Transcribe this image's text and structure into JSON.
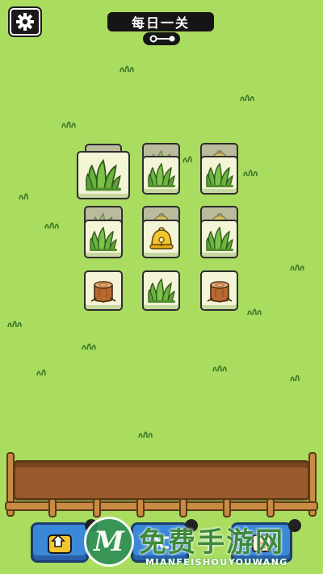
{
  "header": {
    "title": "每日一关",
    "settings_icon": "gear-icon",
    "key_icon": "key-icon"
  },
  "board": {
    "tiles": [
      {
        "icon": "stump-icon",
        "layer": "under"
      },
      {
        "icon": "grass-tuft-icon",
        "layer": "top"
      },
      {
        "icon": "grass-tuft-icon",
        "layer": "under"
      },
      {
        "icon": "grass-tuft-icon",
        "layer": "top"
      },
      {
        "icon": "bell-icon",
        "layer": "under"
      },
      {
        "icon": "grass-tuft-icon",
        "layer": "top"
      },
      {
        "icon": "grass-tuft-icon",
        "layer": "under"
      },
      {
        "icon": "grass-tuft-icon",
        "layer": "top"
      },
      {
        "icon": "bell-icon",
        "layer": "under"
      },
      {
        "icon": "bell-icon",
        "layer": "top"
      },
      {
        "icon": "bell-icon",
        "layer": "under"
      },
      {
        "icon": "grass-tuft-icon",
        "layer": "top"
      },
      {
        "icon": "stump-icon",
        "layer": "top"
      },
      {
        "icon": "grass-tuft-icon",
        "layer": "top"
      },
      {
        "icon": "stump-icon",
        "layer": "top"
      }
    ]
  },
  "tray": {
    "slots": []
  },
  "toolbar": {
    "buttons": [
      {
        "name": "undo-button",
        "icon": "undo-arrow-icon"
      },
      {
        "name": "shuffle-button",
        "icon": "shuffle-icon"
      },
      {
        "name": "remove-button",
        "icon": "remove-icon"
      }
    ]
  },
  "watermark": {
    "title": "免费手游网",
    "subtitle": "MIANFEISHOUYOUWANG",
    "logo_letter": "M"
  },
  "colors": {
    "background": "#a9dc5f",
    "tile_face": "#f4f4d6",
    "button_blue": "#3b88d8",
    "fence_wood": "#c98a43"
  }
}
